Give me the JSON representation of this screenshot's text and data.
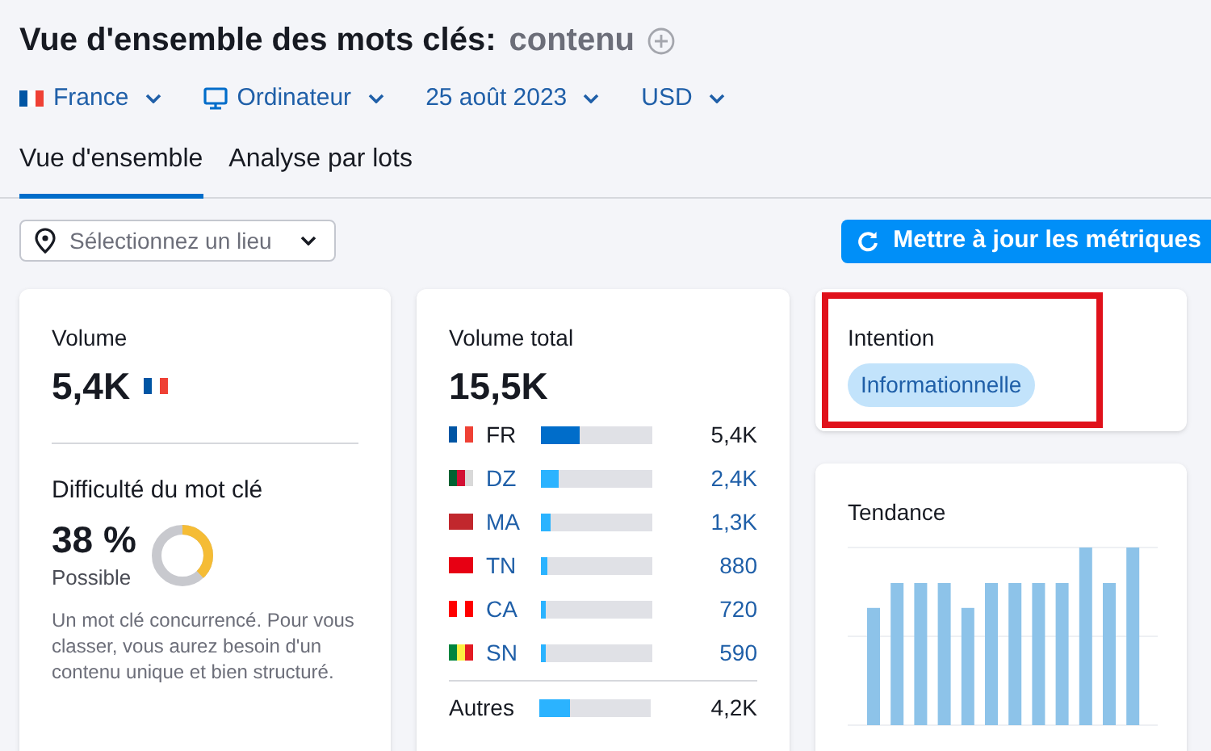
{
  "header": {
    "title": "Vue d'ensemble des mots clés:",
    "keyword": "contenu"
  },
  "filters": [
    {
      "label": "France",
      "kind": "flag"
    },
    {
      "label": "Ordinateur",
      "kind": "device"
    },
    {
      "label": "25 août 2023",
      "kind": "plain"
    },
    {
      "label": "USD",
      "kind": "plain"
    }
  ],
  "tabs": [
    {
      "label": "Vue d'ensemble",
      "selected": true
    },
    {
      "label": "Analyse par lots",
      "selected": false
    }
  ],
  "location_select": {
    "placeholder": "Sélectionnez un lieu"
  },
  "update_button": {
    "label": "Mettre à jour les métriques"
  },
  "volume_card": {
    "label": "Volume",
    "value": "5,4K",
    "difficulty": {
      "label": "Difficulté du mot clé",
      "value": "38 %",
      "level": 0.38,
      "rating": "Possible",
      "description": "Un mot clé concurrencé. Pour vous classer, vous aurez besoin d'un contenu unique et bien structuré."
    }
  },
  "total_card": {
    "label": "Volume total",
    "value": "15,5K",
    "countries": [
      {
        "code": "FR",
        "level": 0.35,
        "value": "5,4K",
        "selected": true
      },
      {
        "code": "DZ",
        "level": 0.16,
        "value": "2,4K",
        "selected": false
      },
      {
        "code": "MA",
        "level": 0.08,
        "value": "1,3K",
        "selected": false
      },
      {
        "code": "TN",
        "level": 0.06,
        "value": "880",
        "selected": false
      },
      {
        "code": "CA",
        "level": 0.05,
        "value": "720",
        "selected": false
      },
      {
        "code": "SN",
        "level": 0.04,
        "value": "590",
        "selected": false
      }
    ],
    "others": {
      "label": "Autres",
      "level": 0.28,
      "value": "4,2K"
    }
  },
  "intent_card": {
    "label": "Intention",
    "badge": "Informationnelle",
    "highlighted": true
  },
  "trend_card": {
    "label": "Tendance"
  }
}
